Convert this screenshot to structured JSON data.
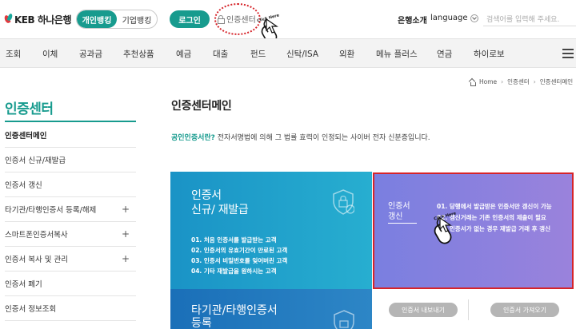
{
  "header": {
    "logo_text": "KEB 하나은행",
    "segment": {
      "personal": "개인뱅킹",
      "business": "기업뱅킹"
    },
    "login": "로그인",
    "cert_center": "인증센터",
    "bank_intro": "은행소개",
    "language": "language",
    "search_placeholder": "검색어를 입력해 주세요."
  },
  "annotation": {
    "click_here": "Click Here"
  },
  "nav": {
    "items": [
      "조회",
      "이체",
      "공과금",
      "추천상품",
      "예금",
      "대출",
      "펀드",
      "신탁/ISA",
      "외환",
      "메뉴 플러스",
      "연금",
      "하이로보"
    ]
  },
  "breadcrumb": {
    "home": "Home",
    "level1": "인증센터",
    "level2": "인증센터메인"
  },
  "sidebar": {
    "title": "인증센터",
    "items": [
      {
        "label": "인증센터메인",
        "expandable": false
      },
      {
        "label": "인증서 신규/재발급",
        "expandable": false
      },
      {
        "label": "인증서 갱신",
        "expandable": false
      },
      {
        "label": "타기관/타행인증서 등록/해제",
        "expandable": true
      },
      {
        "label": "스마트폰인증서복사",
        "expandable": true
      },
      {
        "label": "인증서 복사 및 관리",
        "expandable": true
      },
      {
        "label": "인증서 폐기",
        "expandable": false
      },
      {
        "label": "인증서 정보조회",
        "expandable": false
      }
    ],
    "plus_symbol": "+"
  },
  "main": {
    "title": "인증센터메인",
    "desc_strong": "공인인증서란?",
    "desc_rest": " 전자서명법에 의해 그 법률 효력이 인정되는 사이버 전자 신분증입니다.",
    "card_issue": {
      "title_line1": "인증서",
      "title_line2": "신규/ 재발급",
      "list": [
        "01. 처음 인증서를 발급받는 고객",
        "02. 인증서의 유효기간이 만료된 고객",
        "03. 인증서 비밀번호를 잊어버린 고객",
        "04. 기타 재발급을 원하시는 고객"
      ]
    },
    "card_other": {
      "title_line1": "타기관/타행인증서",
      "title_line2": "등록"
    },
    "card_renew": {
      "title_line1": "인증서",
      "title_line2": "갱신",
      "list": [
        "01. 당행에서 발급받은 인증서만 갱신이 가능",
        "02. 갱신거래는 기존 인증서의 제출이 필요",
        "03. 인증서가 없는 경우 재발급 거래 후 갱신"
      ]
    },
    "buttons": {
      "export": "인증서 내보내기",
      "import": "인증서 가져오기"
    }
  },
  "colors": {
    "brand": "#179b8e",
    "card_blue": "#1a93c6",
    "card_purple": "#8a80de",
    "highlight_red": "#d6242a"
  }
}
